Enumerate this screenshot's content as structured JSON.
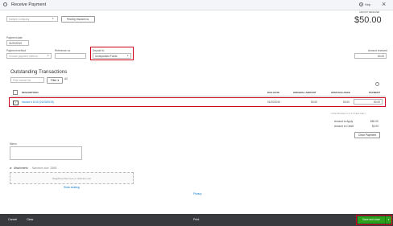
{
  "header": {
    "title": "Receive Payment",
    "help_label": "Help"
  },
  "customer": {
    "value": "Sample Company",
    "find_invoice_label": "Find by invoice no."
  },
  "amount_received": {
    "label": "AMOUNT RECEIVED",
    "value": "$50.00"
  },
  "payment_date": {
    "label": "Payment date",
    "value": "01/20/2019"
  },
  "payment_method": {
    "label": "Payment method",
    "placeholder": "Choose payment method"
  },
  "reference": {
    "label": "Reference no."
  },
  "deposit_to": {
    "label": "Deposit to",
    "value": "Undeposited Funds"
  },
  "amount_received_field": {
    "label": "Amount received",
    "value": "50.00"
  },
  "outstanding": {
    "title": "Outstanding Transactions",
    "search_placeholder": "Find Invoice No.",
    "filter_label": "Filter",
    "all_label": "All",
    "columns": [
      "DESCRIPTION",
      "DUE DATE",
      "ORIGINAL AMOUNT",
      "OPEN BALANCE",
      "PAYMENT"
    ],
    "rows": [
      {
        "description": "Invoice # 1010 (01/20/2019)",
        "due_date": "01/20/2019",
        "original_amount": "50.00",
        "open_balance": "50.00",
        "payment": "50.00"
      }
    ],
    "pager": "< First  Previous  1-1 of 1  Next  Last >"
  },
  "totals": {
    "amount_to_apply_label": "Amount to Apply",
    "amount_to_apply_value": "$50.00",
    "amount_to_credit_label": "Amount to Credit",
    "amount_to_credit_value": "$0.00",
    "clear_payment_label": "Clear Payment"
  },
  "memo": {
    "label": "Memo"
  },
  "attachments": {
    "label": "Attachments",
    "max_size": "Maximum size: 25MB",
    "drop_text": "Drag/Drop files here or click the icon",
    "show_existing": "Show existing"
  },
  "privacy_label": "Privacy",
  "footer": {
    "cancel_label": "Cancel",
    "clear_label": "Clear",
    "print_label": "Print",
    "save_close_label": "Save and close"
  },
  "colors": {
    "accent_green": "#2ca01c",
    "footer_bg": "#393a3d",
    "highlight_red": "#d0021b",
    "link_blue": "#0077c5"
  }
}
